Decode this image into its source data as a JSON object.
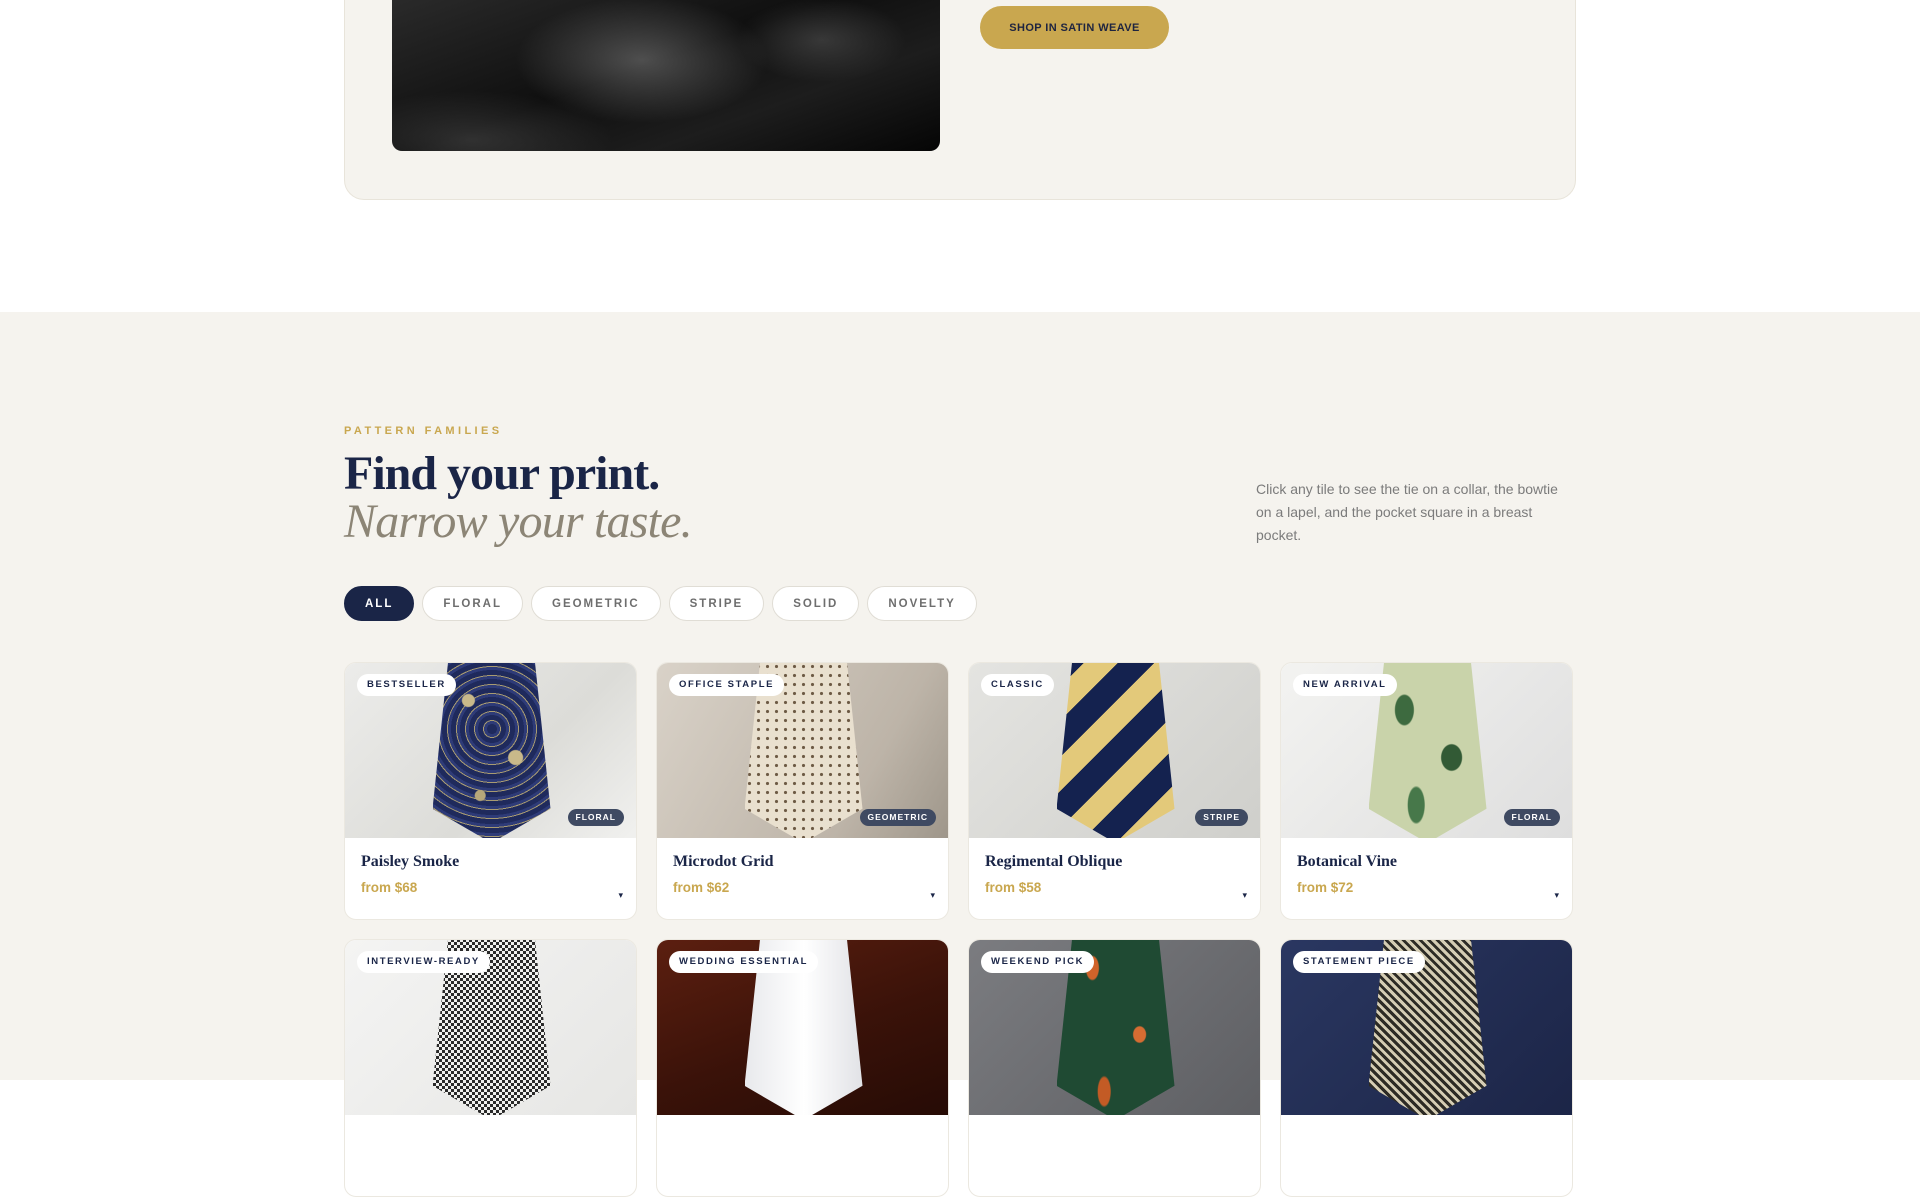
{
  "hero": {
    "shop_button": "SHOP IN SATIN WEAVE",
    "photo_icon": "black-satin-fabric-photo"
  },
  "families": {
    "eyebrow": "PATTERN FAMILIES",
    "title": "Find your print.",
    "subtitle": "Narrow your taste.",
    "intro": "Click any tile to see the tie on a collar, the bowtie on a lapel, and the pocket square in a breast pocket.",
    "filters": [
      {
        "label": "ALL",
        "active": true
      },
      {
        "label": "FLORAL",
        "active": false
      },
      {
        "label": "GEOMETRIC",
        "active": false
      },
      {
        "label": "STRIPE",
        "active": false
      },
      {
        "label": "SOLID",
        "active": false
      },
      {
        "label": "NOVELTY",
        "active": false
      }
    ],
    "products": [
      {
        "tag": "BESTSELLER",
        "family": "FLORAL",
        "name": "Paisley Smoke",
        "price": "from $68",
        "caret": "▾"
      },
      {
        "tag": "OFFICE STAPLE",
        "family": "GEOMETRIC",
        "name": "Microdot Grid",
        "price": "from $62",
        "caret": "▾"
      },
      {
        "tag": "CLASSIC",
        "family": "STRIPE",
        "name": "Regimental Oblique",
        "price": "from $58",
        "caret": "▾"
      },
      {
        "tag": "NEW ARRIVAL",
        "family": "FLORAL",
        "name": "Botanical Vine",
        "price": "from $72",
        "caret": "▾"
      },
      {
        "tag": "INTERVIEW-READY"
      },
      {
        "tag": "WEDDING ESSENTIAL"
      },
      {
        "tag": "WEEKEND PICK"
      },
      {
        "tag": "STATEMENT PIECE"
      }
    ]
  },
  "colors": {
    "navy": "#1a2547",
    "gold": "#c9a74f",
    "section_bg": "#f5f3ee"
  }
}
